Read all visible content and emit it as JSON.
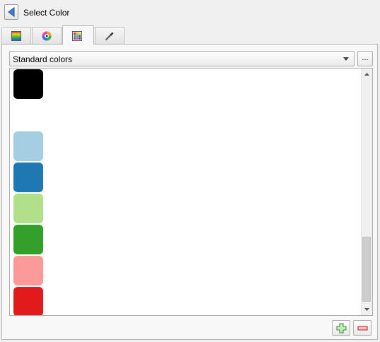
{
  "window": {
    "title": "Select Color"
  },
  "tabs": [
    {
      "icon": "color-ramp-icon",
      "active": false
    },
    {
      "icon": "color-wheel-icon",
      "active": false
    },
    {
      "icon": "color-palette-grid-icon",
      "active": true
    },
    {
      "icon": "eyedropper-icon",
      "active": false
    }
  ],
  "palette_selector": {
    "value": "Standard colors",
    "more_label": "..."
  },
  "swatches": [
    {
      "color": "#000000"
    },
    {
      "color": "#ffffff"
    },
    {
      "color": "#a6cee3"
    },
    {
      "color": "#1f78b4"
    },
    {
      "color": "#b2df8a"
    },
    {
      "color": "#33a02c"
    },
    {
      "color": "#fb9a99"
    },
    {
      "color": "#e31a1c"
    }
  ],
  "scrollbar": {
    "position": 0.85
  },
  "actions": {
    "add_icon": "plus-icon",
    "remove_icon": "minus-icon"
  }
}
